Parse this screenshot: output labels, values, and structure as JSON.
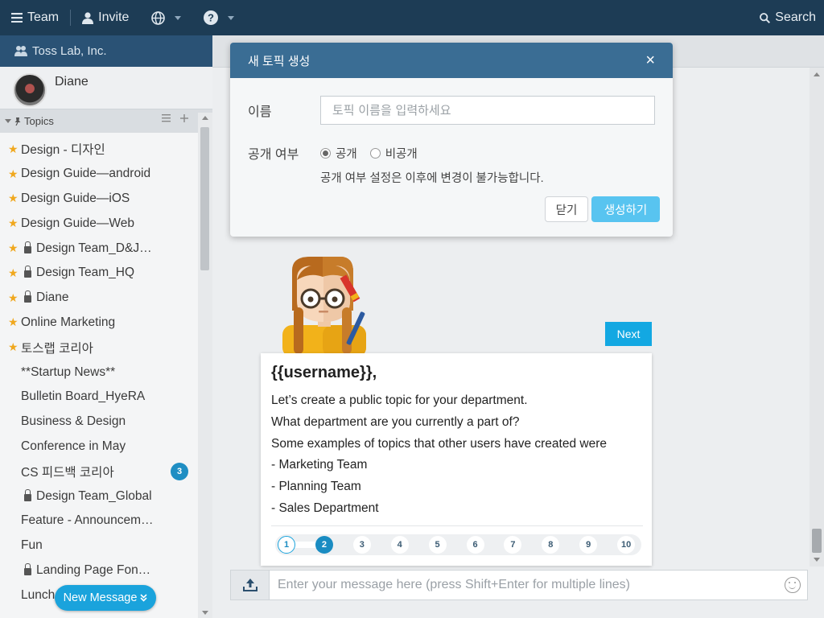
{
  "topbar": {
    "team_label": "Team",
    "invite_label": "Invite",
    "search_label": "Search"
  },
  "sidebar": {
    "team_name": "Toss Lab, Inc.",
    "user_name": "Diane",
    "topics_title": "Topics",
    "topics": [
      {
        "label": "Design - 디자인",
        "starred": true,
        "locked": false
      },
      {
        "label": "Design Guide—android",
        "starred": true,
        "locked": false
      },
      {
        "label": "Design Guide—iOS",
        "starred": true,
        "locked": false
      },
      {
        "label": "Design Guide—Web",
        "starred": true,
        "locked": false
      },
      {
        "label": "Design Team_D&J…",
        "starred": true,
        "locked": true
      },
      {
        "label": "Design Team_HQ",
        "starred": true,
        "locked": true
      },
      {
        "label": "Diane",
        "starred": true,
        "locked": true
      },
      {
        "label": "Online Marketing",
        "starred": true,
        "locked": false
      },
      {
        "label": "토스랩 코리아",
        "starred": true,
        "locked": false
      },
      {
        "label": "**Startup News**",
        "starred": false,
        "locked": false
      },
      {
        "label": "Bulletin Board_HyeRA",
        "starred": false,
        "locked": false
      },
      {
        "label": "Business & Design",
        "starred": false,
        "locked": false
      },
      {
        "label": "Conference in May",
        "starred": false,
        "locked": false
      },
      {
        "label": "CS 피드백 코리아",
        "starred": false,
        "locked": false,
        "badge": "3"
      },
      {
        "label": "Design Team_Global",
        "starred": false,
        "locked": true
      },
      {
        "label": "Feature - Announcem…",
        "starred": false,
        "locked": false
      },
      {
        "label": "Fun",
        "starred": false,
        "locked": false
      },
      {
        "label": "Landing Page Fon…",
        "starred": false,
        "locked": true
      },
      {
        "label": "Lunch",
        "starred": false,
        "locked": false
      }
    ],
    "new_message_label": "New Message"
  },
  "dialog": {
    "title": "새 토픽 생성",
    "name_label": "이름",
    "name_placeholder": "토픽 이름을 입력하세요",
    "visibility_label": "공개 여부",
    "option_public": "공개",
    "option_private": "비공개",
    "selected": "공개",
    "note": "공개 여부 설정은 이후에 변경이 불가능합니다.",
    "close_button": "닫기",
    "create_button": "생성하기"
  },
  "onboarding": {
    "next_label": "Next",
    "title": "{{username}},",
    "lines": [
      "Let’s create a public topic for your department.",
      "What department are you currently a part of?",
      "Some examples of topics that other users have created were",
      "- Marketing Team",
      "- Planning Team",
      "- Sales Department"
    ],
    "steps": [
      "1",
      "2",
      "3",
      "4",
      "5",
      "6",
      "7",
      "8",
      "9",
      "10"
    ],
    "current_step": 2
  },
  "composer": {
    "placeholder": "Enter your message here (press Shift+Enter for multiple lines)"
  },
  "colors": {
    "topbar": "#1d3c55",
    "team_bar": "#2a5275",
    "dialog_header": "#3a6d94",
    "accent": "#1aa3dc",
    "create_button": "#58c4f0",
    "star": "#f0a81e"
  }
}
